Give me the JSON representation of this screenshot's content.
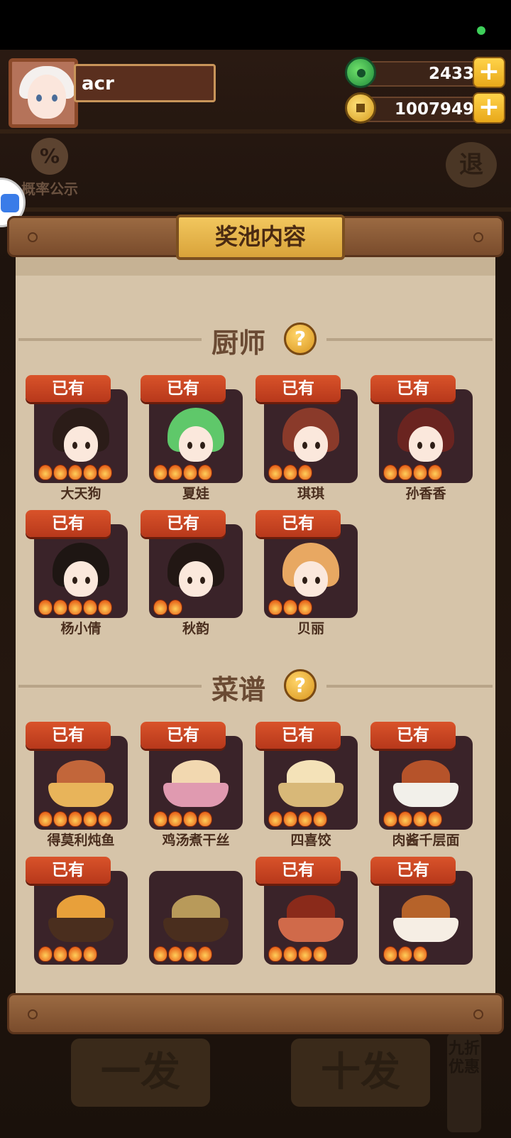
{
  "player": {
    "name": "acr"
  },
  "currency": {
    "jade": "2433",
    "gold": "1007949",
    "plus": "+"
  },
  "background": {
    "probability_label": "概率公示",
    "probability_icon": "%",
    "exit_label": "退",
    "draw_one": "一发",
    "draw_ten": "十发",
    "discount": "九折优惠"
  },
  "panel": {
    "title": "奖池内容",
    "help_glyph": "?",
    "chef_section": "厨师",
    "recipe_section": "菜谱",
    "owned_label": "已有",
    "chefs": [
      {
        "name": "大天狗",
        "owned": true,
        "flames": 5,
        "hair": "#2b1c18"
      },
      {
        "name": "夏娃",
        "owned": true,
        "flames": 4,
        "hair": "#5fc86a"
      },
      {
        "name": "琪琪",
        "owned": true,
        "flames": 3,
        "hair": "#8a3a2a"
      },
      {
        "name": "孙香香",
        "owned": true,
        "flames": 4,
        "hair": "#6a2420"
      },
      {
        "name": "杨小倩",
        "owned": true,
        "flames": 5,
        "hair": "#1e1613"
      },
      {
        "name": "秋韵",
        "owned": true,
        "flames": 2,
        "hair": "#221714"
      },
      {
        "name": "贝丽",
        "owned": true,
        "flames": 3,
        "hair": "#e8a862"
      }
    ],
    "recipes": [
      {
        "name": "得莫利炖鱼",
        "owned": true,
        "flames": 5,
        "food": "#c2663a",
        "bowl": "#e8b45a"
      },
      {
        "name": "鸡汤煮干丝",
        "owned": true,
        "flames": 4,
        "food": "#f2d8b0",
        "bowl": "#e09ab0"
      },
      {
        "name": "四喜饺",
        "owned": true,
        "flames": 4,
        "food": "#f4e2b8",
        "bowl": "#d8b878"
      },
      {
        "name": "肉酱千层面",
        "owned": true,
        "flames": 4,
        "food": "#b6532a",
        "bowl": "#f2f0ea"
      },
      {
        "name": "",
        "owned": true,
        "flames": 4,
        "food": "#e8a03a",
        "bowl": "#4a2e1e"
      },
      {
        "name": "",
        "owned": false,
        "flames": 4,
        "food": "#b89a5a",
        "bowl": "#4a2e1e"
      },
      {
        "name": "",
        "owned": true,
        "flames": 4,
        "food": "#8a2a1a",
        "bowl": "#d06a4a"
      },
      {
        "name": "",
        "owned": true,
        "flames": 3,
        "food": "#b6632a",
        "bowl": "#f6eee4"
      }
    ]
  }
}
